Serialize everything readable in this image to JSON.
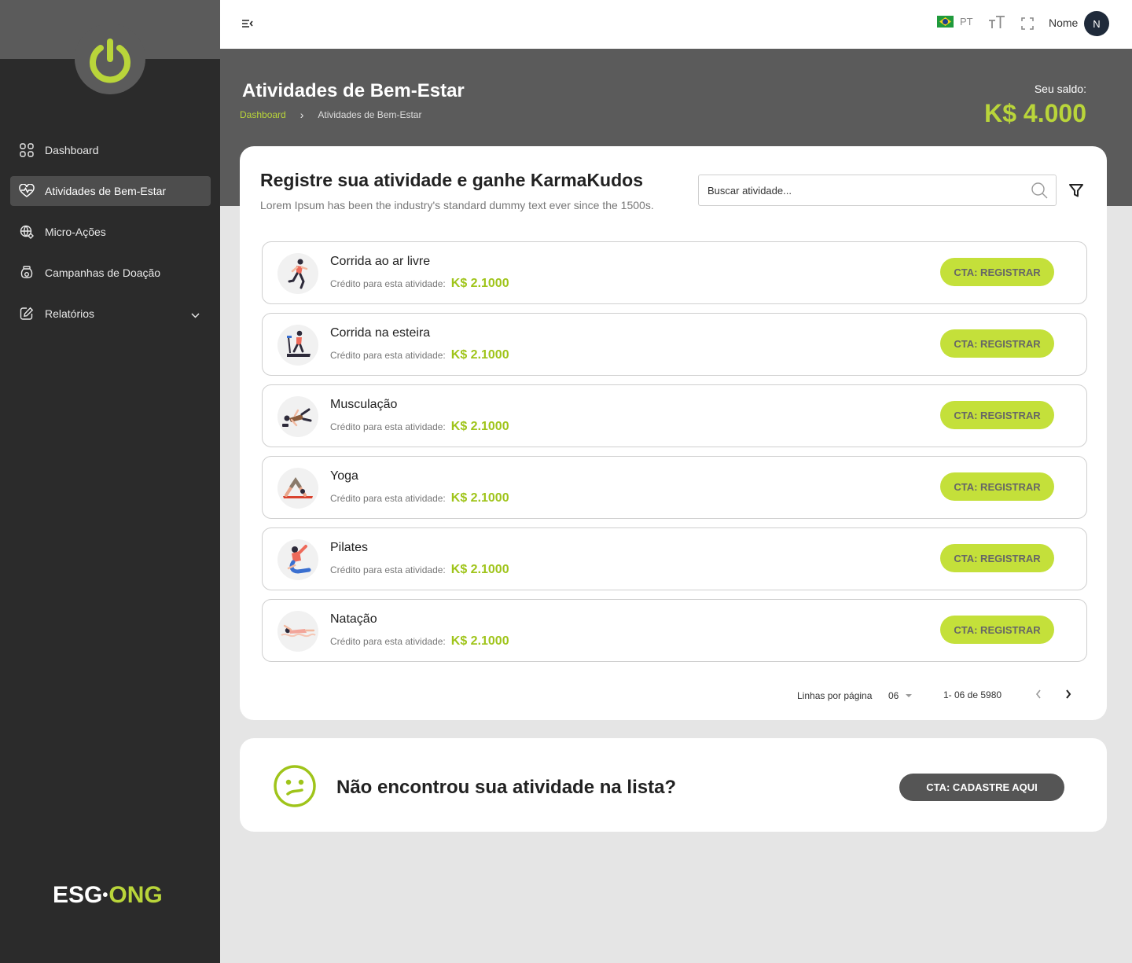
{
  "sidebar": {
    "items": [
      {
        "label": "Dashboard"
      },
      {
        "label": "Atividades de Bem-Estar"
      },
      {
        "label": "Micro-Ações"
      },
      {
        "label": "Campanhas de Doação"
      },
      {
        "label": "Relatórios"
      }
    ],
    "brand_left": "ESG",
    "brand_right": "ONG"
  },
  "topbar": {
    "language": "PT",
    "user_name": "Nome",
    "avatar_initial": "N"
  },
  "header": {
    "title": "Atividades de Bem-Estar",
    "breadcrumb": [
      "Dashboard",
      "Atividades de Bem-Estar"
    ],
    "balance_label": "Seu saldo:",
    "balance_value": "K$ 4.000"
  },
  "main": {
    "title": "Registre sua atividade e ganhe KarmaKudos",
    "subtitle": "Lorem Ipsum has been the industry's standard dummy text ever since the 1500s.",
    "search_placeholder": "Buscar atividade...",
    "credit_label": "Crédito para esta atividade:",
    "cta_label": "CTA: REGISTRAR",
    "activities": [
      {
        "name": "Corrida ao ar livre",
        "credit": "K$ 2.1000"
      },
      {
        "name": "Corrida na esteira",
        "credit": "K$ 2.1000"
      },
      {
        "name": "Musculação",
        "credit": "K$ 2.1000"
      },
      {
        "name": "Yoga",
        "credit": "K$ 2.1000"
      },
      {
        "name": "Pilates",
        "credit": "K$ 2.1000"
      },
      {
        "name": "Natação",
        "credit": "K$ 2.1000"
      }
    ],
    "pagination": {
      "rows_label": "Linhas por página",
      "rows_value": "06",
      "range": "1- 06 de 5980"
    }
  },
  "not_found": {
    "title": "Não encontrou sua atividade na lista?",
    "cta_label": "CTA: CADASTRE AQUI"
  },
  "colors": {
    "accent": "#b9d53a",
    "sidebar_bg": "#2b2b2b",
    "header_bg": "#5b5b5b"
  }
}
